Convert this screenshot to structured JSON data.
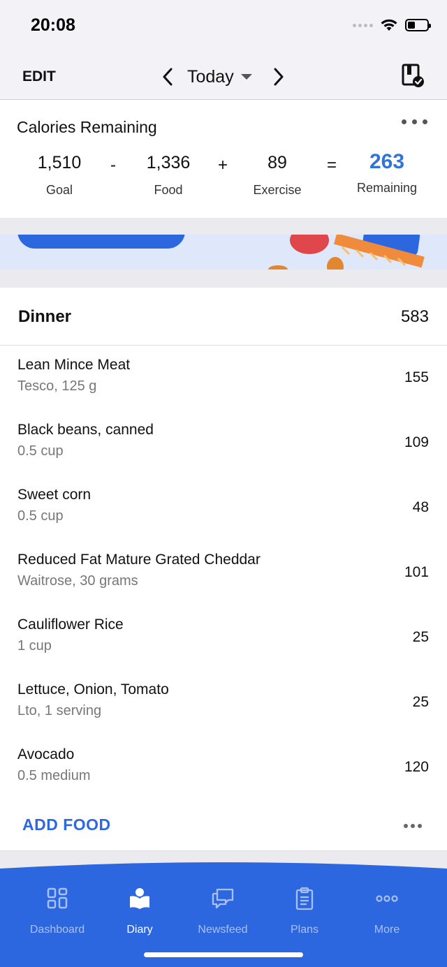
{
  "status_bar": {
    "time": "20:08",
    "icons": [
      "signal-icon",
      "wifi-icon",
      "battery-icon"
    ]
  },
  "header": {
    "edit_label": "EDIT",
    "date_label": "Today",
    "icons": [
      "chevron-left-icon",
      "dropdown-caret-icon",
      "chevron-right-icon",
      "calendar-check-icon"
    ]
  },
  "calories": {
    "title": "Calories Remaining",
    "goal_value": "1,510",
    "goal_label": "Goal",
    "op_minus": "-",
    "food_value": "1,336",
    "food_label": "Food",
    "op_plus": "+",
    "exercise_value": "89",
    "exercise_label": "Exercise",
    "op_equals": "=",
    "remaining_value": "263",
    "remaining_label": "Remaining",
    "remaining_color": "#2f75d9"
  },
  "dinner": {
    "title": "Dinner",
    "total": "583",
    "items": [
      {
        "name": "Lean Mince Meat",
        "detail": "Tesco, 125 g",
        "calories": "155"
      },
      {
        "name": "Black beans, canned",
        "detail": "0.5 cup",
        "calories": "109"
      },
      {
        "name": "Sweet corn",
        "detail": "0.5 cup",
        "calories": "48"
      },
      {
        "name": "Reduced Fat Mature Grated Cheddar",
        "detail": "Waitrose, 30 grams",
        "calories": "101"
      },
      {
        "name": "Cauliflower Rice",
        "detail": "1 cup",
        "calories": "25"
      },
      {
        "name": "Lettuce, Onion, Tomato",
        "detail": "Lto, 1 serving",
        "calories": "25"
      },
      {
        "name": "Avocado",
        "detail": "0.5 medium",
        "calories": "120"
      }
    ],
    "add_food_label": "ADD FOOD",
    "accent_color": "#2f67dd"
  },
  "tab_bar": {
    "background_color": "#2d67e0",
    "active_tab": "Diary",
    "tabs": [
      {
        "label": "Dashboard",
        "icon": "dashboard-icon"
      },
      {
        "label": "Diary",
        "icon": "diary-icon"
      },
      {
        "label": "Newsfeed",
        "icon": "newsfeed-icon"
      },
      {
        "label": "Plans",
        "icon": "plans-icon"
      },
      {
        "label": "More",
        "icon": "more-icon"
      }
    ]
  }
}
